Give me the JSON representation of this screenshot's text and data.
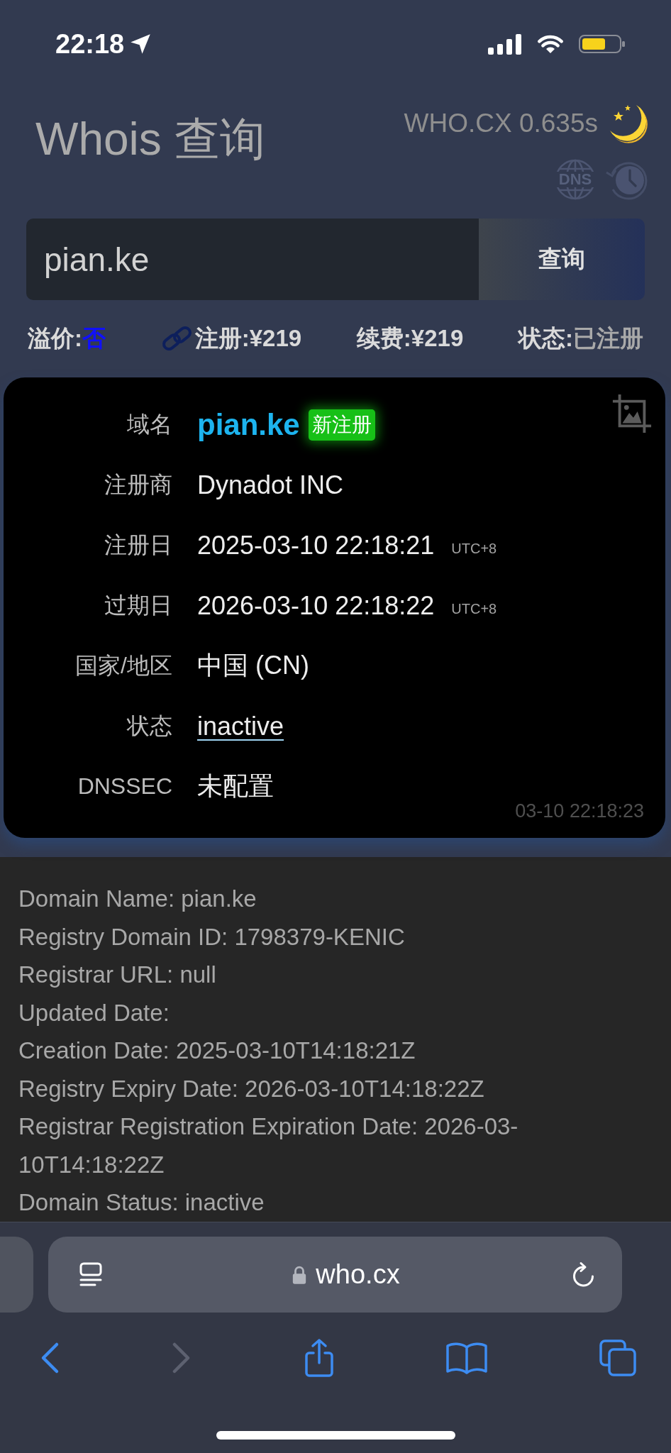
{
  "status_bar": {
    "time": "22:18"
  },
  "header": {
    "title": "Whois 查询",
    "timing": "WHO.CX 0.635s",
    "dns_label": "DNS"
  },
  "search": {
    "value": "pian.ke",
    "button": "查询"
  },
  "summary": [
    {
      "kind": "flag",
      "label": "溢价:",
      "value": "否"
    },
    {
      "kind": "linked",
      "label": "注册:",
      "value": "¥219"
    },
    {
      "kind": "price",
      "label": "续费:",
      "value": "¥219"
    },
    {
      "kind": "status",
      "label": "状态:",
      "value": "已注册"
    }
  ],
  "result": {
    "fields": [
      {
        "kind": "domain",
        "label": "域名",
        "value": "pian.ke",
        "badge": "新注册"
      },
      {
        "kind": "text",
        "label": "注册商",
        "value": "Dynadot INC"
      },
      {
        "kind": "date",
        "label": "注册日",
        "value": "2025-03-10 22:18:21",
        "zone": "UTC+8"
      },
      {
        "kind": "date",
        "label": "过期日",
        "value": "2026-03-10 22:18:22",
        "zone": "UTC+8"
      },
      {
        "kind": "text",
        "label": "国家/地区",
        "value": "中国 (CN)"
      },
      {
        "kind": "link",
        "label": "状态",
        "value": "inactive"
      },
      {
        "kind": "text",
        "label": "DNSSEC",
        "value": "未配置"
      }
    ],
    "timestamp": "03-10 22:18:23"
  },
  "raw_whois": [
    "Domain Name: pian.ke",
    "Registry Domain ID: 1798379-KENIC",
    "Registrar URL: null",
    "Updated Date:",
    "Creation Date: 2025-03-10T14:18:21Z",
    "Registry Expiry Date: 2026-03-10T14:18:22Z",
    "Registrar Registration Expiration Date: 2026-03-10T14:18:22Z",
    "Domain Status: inactive"
  ],
  "browser": {
    "url": "who.cx",
    "toolbar": [
      {
        "kind": "back",
        "disabled": false
      },
      {
        "kind": "forward",
        "disabled": true
      },
      {
        "kind": "share",
        "disabled": false
      },
      {
        "kind": "bookmarks",
        "disabled": false
      },
      {
        "kind": "tabs",
        "disabled": false
      }
    ]
  }
}
